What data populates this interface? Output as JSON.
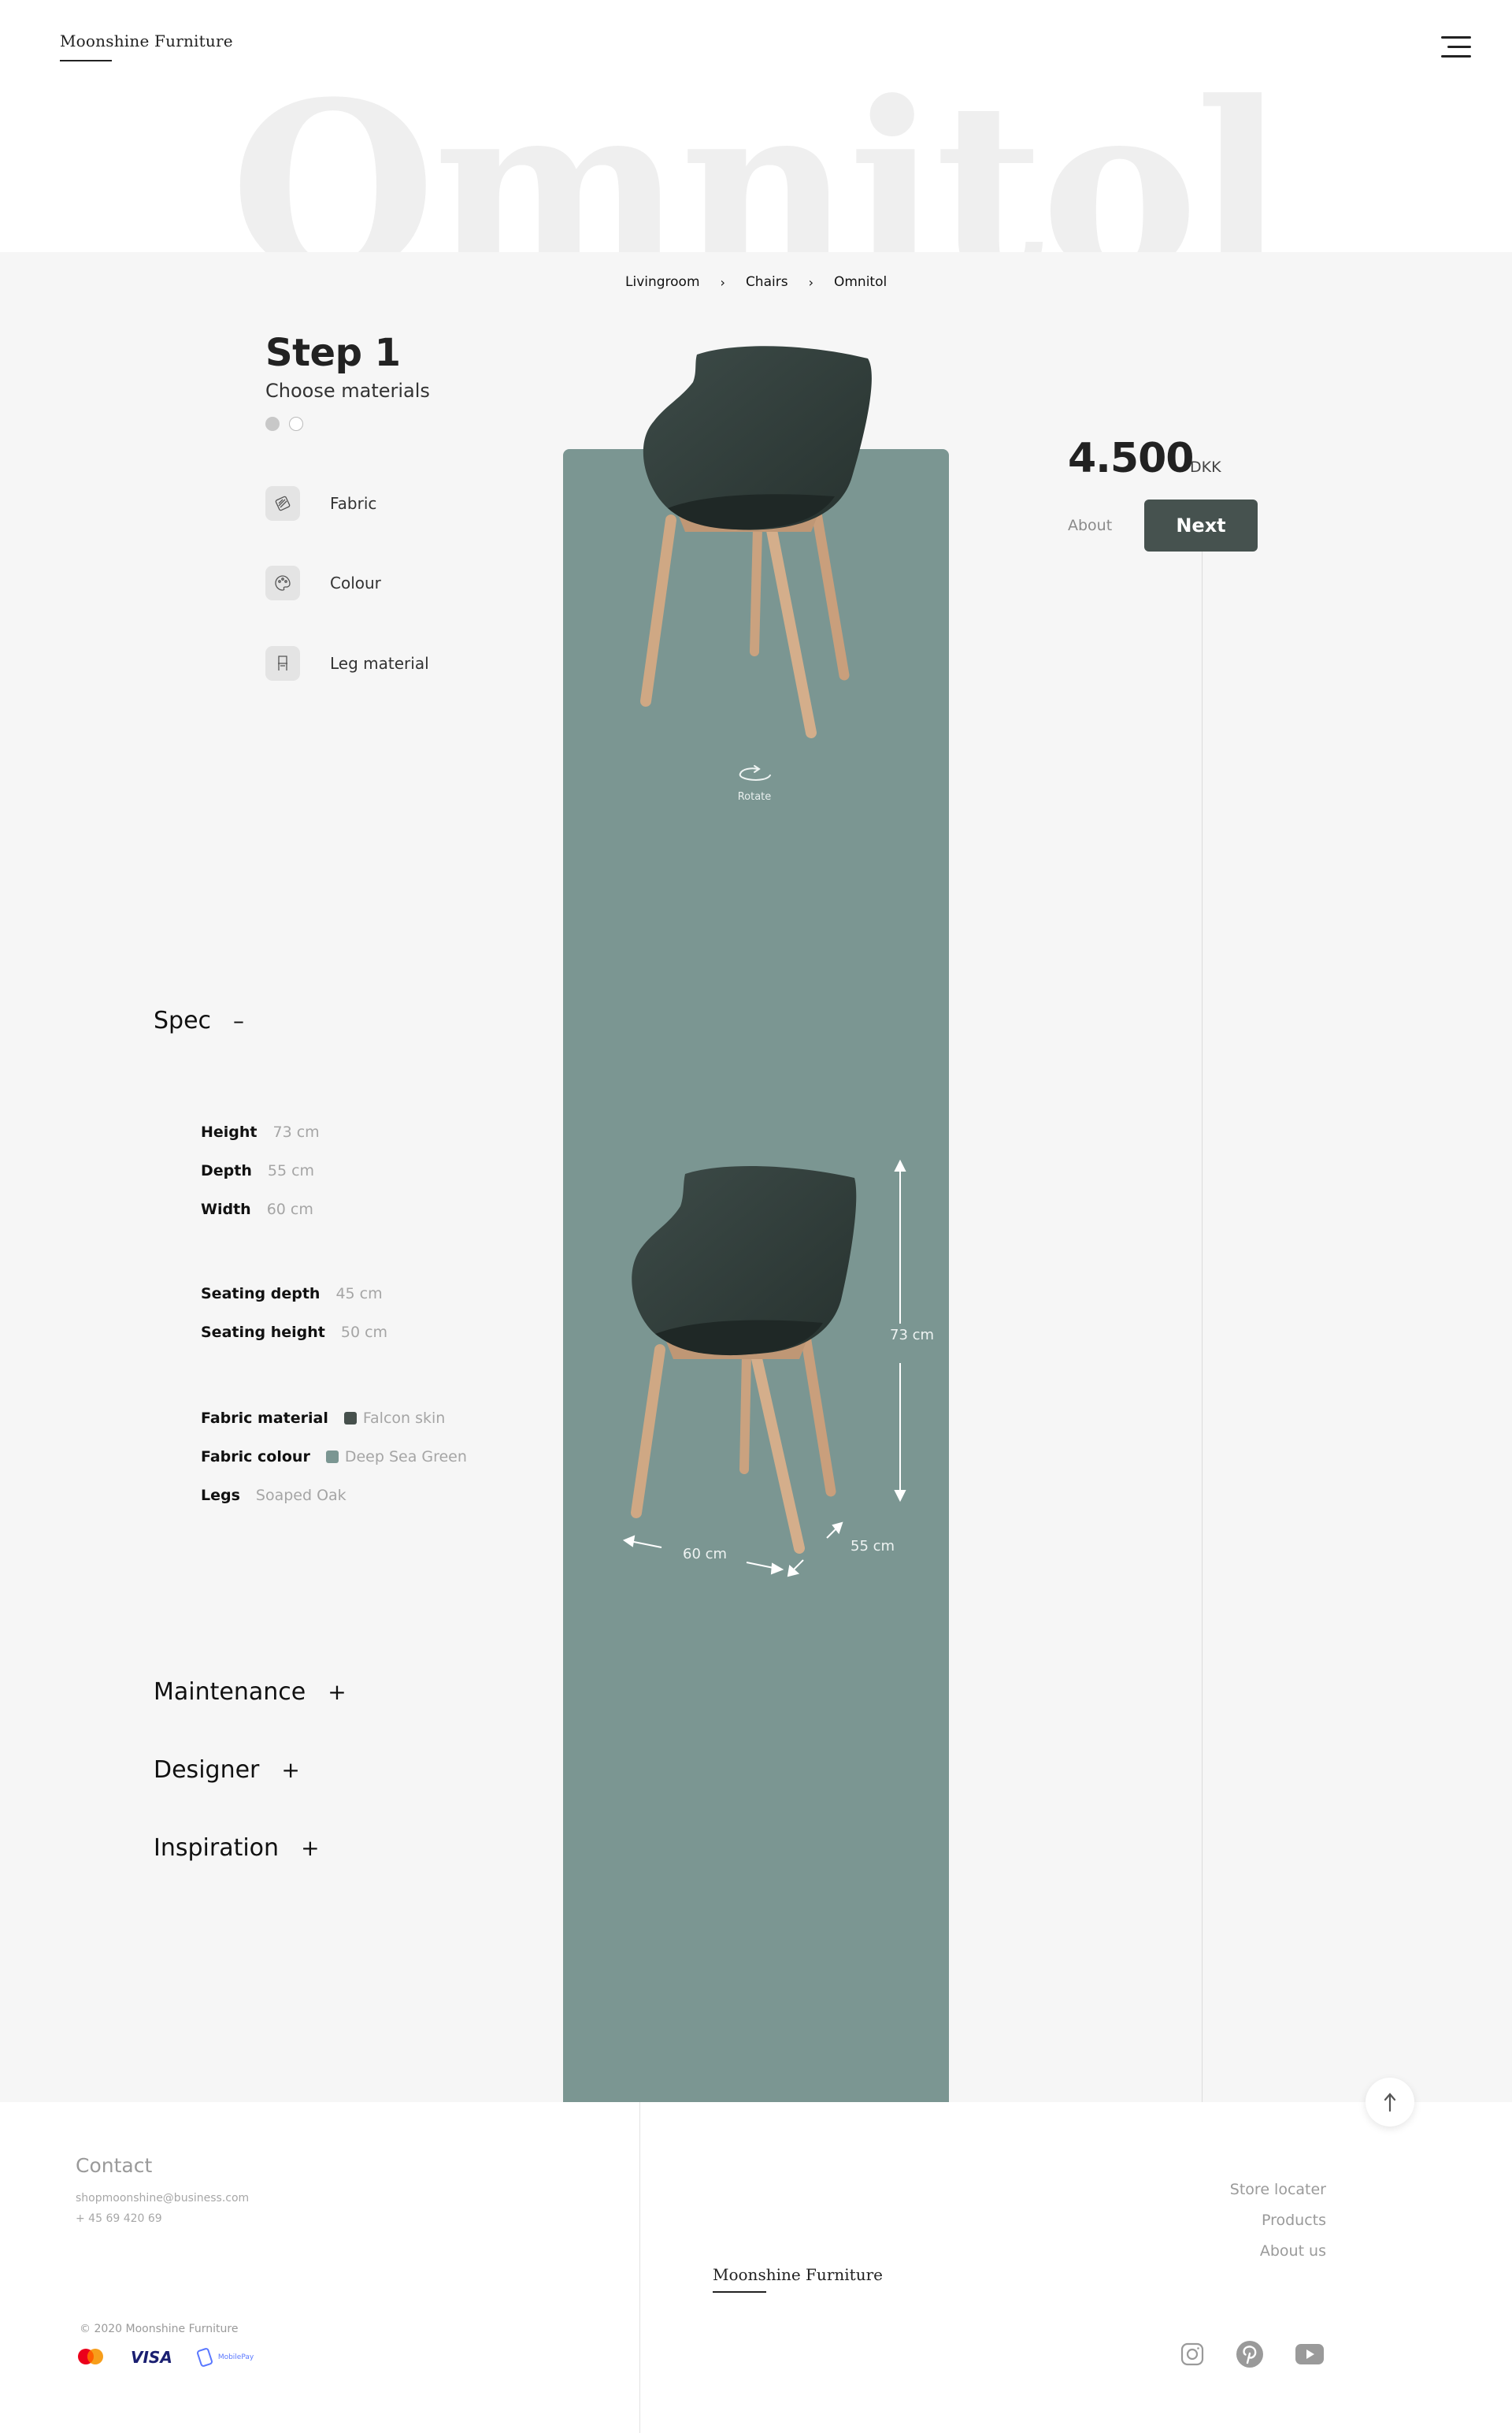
{
  "brand": {
    "name": "Moonshine Furniture"
  },
  "hero": {
    "title": "Omnitol"
  },
  "breadcrumb": [
    "Livingroom",
    "Chairs",
    "Omnitol"
  ],
  "step": {
    "title": "Step 1",
    "subtitle": "Choose materials"
  },
  "options": [
    {
      "label": "Fabric",
      "icon": "fabric-icon"
    },
    {
      "label": "Colour",
      "icon": "palette-icon"
    },
    {
      "label": "Leg material",
      "icon": "chair-legs-icon"
    }
  ],
  "viewer": {
    "rotate_label": "Rotate"
  },
  "dimensions": {
    "height": "73 cm",
    "width": "60 cm",
    "depth": "55 cm"
  },
  "price": {
    "amount": "4.500",
    "currency": "DKK"
  },
  "actions": {
    "about_label": "About",
    "next_label": "Next"
  },
  "spec": {
    "title": "Spec",
    "toggle": "–",
    "rows": [
      {
        "label": "Height",
        "value": "73 cm"
      },
      {
        "label": "Depth",
        "value": "55 cm"
      },
      {
        "label": "Width",
        "value": "60 cm"
      },
      {
        "label": "Seating depth",
        "value": "45 cm"
      },
      {
        "label": "Seating height",
        "value": "50 cm"
      },
      {
        "label": "Fabric material",
        "value": "Falcon skin",
        "swatch": "#46504c"
      },
      {
        "label": "Fabric colour",
        "value": "Deep Sea Green",
        "swatch": "#7b9692"
      },
      {
        "label": "Legs",
        "value": "Soaped Oak"
      }
    ]
  },
  "accordions": [
    {
      "title": "Maintenance",
      "toggle": "+"
    },
    {
      "title": "Designer",
      "toggle": "+"
    },
    {
      "title": "Inspiration",
      "toggle": "+"
    }
  ],
  "footer": {
    "contact_title": "Contact",
    "email": "shopmoonshine@business.com",
    "phone": "+ 45 69 420 69",
    "copyright": "© 2020 Moonshine Furniture",
    "payments": {
      "visa": "VISA",
      "mobilepay": "MobilePay"
    },
    "links": [
      "Store locater",
      "Products",
      "About us"
    ],
    "social": [
      "instagram-icon",
      "pinterest-icon",
      "youtube-icon"
    ]
  },
  "colors": {
    "accent": "#46524f",
    "panel": "#7b9692",
    "chair_fabric": "#34423f",
    "wood": "#d2ab87"
  }
}
